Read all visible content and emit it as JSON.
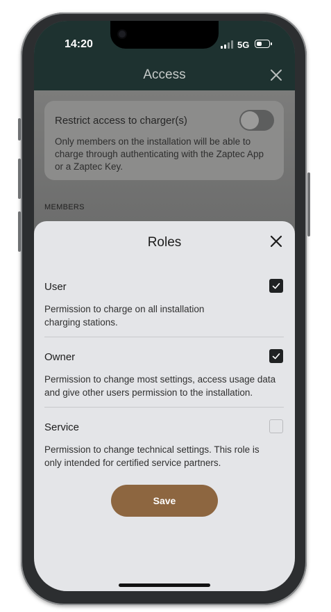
{
  "status_bar": {
    "time": "14:20",
    "network": "5G"
  },
  "header": {
    "title": "Access"
  },
  "restrict": {
    "title": "Restrict access to charger(s)",
    "enabled": false,
    "description": "Only members on the installation will be able to charge through authenticating with the Zaptec App or a Zaptec Key."
  },
  "members_label": "MEMBERS",
  "roles_sheet": {
    "title": "Roles",
    "roles": [
      {
        "name": "User",
        "checked": true,
        "description_line1": "Permission to charge on all installation",
        "description_line2": "charging stations."
      },
      {
        "name": "Owner",
        "checked": true,
        "description_line1": "Permission to change most settings, access usage data",
        "description_line2": "and give other users permission to the installation."
      },
      {
        "name": "Service",
        "checked": false,
        "description_line1": "Permission to change technical settings. This role is",
        "description_line2": "only intended for certified service partners."
      }
    ],
    "save_label": "Save"
  },
  "colors": {
    "header_bg": "#1e3230",
    "sheet_bg": "#e4e5e8",
    "save_button": "#8d6640",
    "checkbox_checked": "#202223"
  },
  "icons": {
    "close": "close-icon",
    "check": "check-icon"
  }
}
